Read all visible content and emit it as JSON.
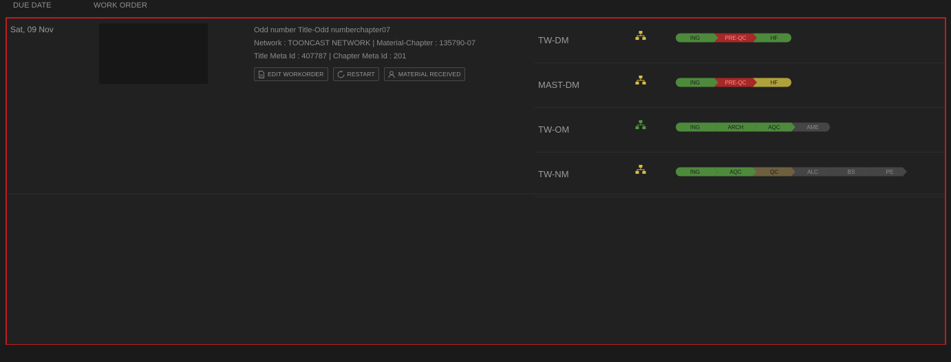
{
  "columns": {
    "due_date": "DUE DATE",
    "work_order": "WORK ORDER"
  },
  "work_order": {
    "due_date": "Sat, 09 Nov",
    "title": "Odd number Title-Odd numberchapter07",
    "network_line": "Network : TOONCAST NETWORK  | Material-Chapter : 135790-07",
    "meta_line": "Title Meta Id : 407787  | Chapter Meta Id : 201",
    "actions": [
      {
        "label": "EDIT WORKORDER",
        "icon": "document-icon"
      },
      {
        "label": "RESTART",
        "icon": "restart-icon"
      },
      {
        "label": "MATERIAL RECEIVED",
        "icon": "user-icon"
      }
    ]
  },
  "colors": {
    "green": "#4d8a3c",
    "red": "#a82828",
    "yellow": "#b0a23a",
    "gray": "#454545",
    "brown": "#6e5f3e",
    "icon_yellow": "#d6c045",
    "icon_green": "#4f9a3e"
  },
  "tracks": [
    {
      "name": "TW-DM",
      "icon_color": "#d6c045",
      "stages": [
        {
          "label": "ING",
          "color": "#4d8a3c"
        },
        {
          "label": "PRE-QC",
          "color": "#a82828"
        },
        {
          "label": "HF",
          "color": "#4d8a3c"
        }
      ]
    },
    {
      "name": "MAST-DM",
      "icon_color": "#d6c045",
      "stages": [
        {
          "label": "ING",
          "color": "#4d8a3c"
        },
        {
          "label": "PRE-QC",
          "color": "#a82828"
        },
        {
          "label": "HF",
          "color": "#b0a23a"
        }
      ]
    },
    {
      "name": "TW-OM",
      "icon_color": "#4f9a3e",
      "stages": [
        {
          "label": "ING",
          "color": "#4d8a3c"
        },
        {
          "label": "ARCH",
          "color": "#4d8a3c"
        },
        {
          "label": "AQC",
          "color": "#4d8a3c"
        },
        {
          "label": "AME",
          "color": "#454545"
        }
      ]
    },
    {
      "name": "TW-NM",
      "icon_color": "#d6c045",
      "stages": [
        {
          "label": "ING",
          "color": "#4d8a3c"
        },
        {
          "label": "AQC",
          "color": "#4d8a3c"
        },
        {
          "label": "QC",
          "color": "#6e5f3e"
        },
        {
          "label": "ALC",
          "color": "#454545"
        },
        {
          "label": "BS",
          "color": "#454545"
        },
        {
          "label": "PE",
          "color": "#454545"
        }
      ]
    }
  ]
}
